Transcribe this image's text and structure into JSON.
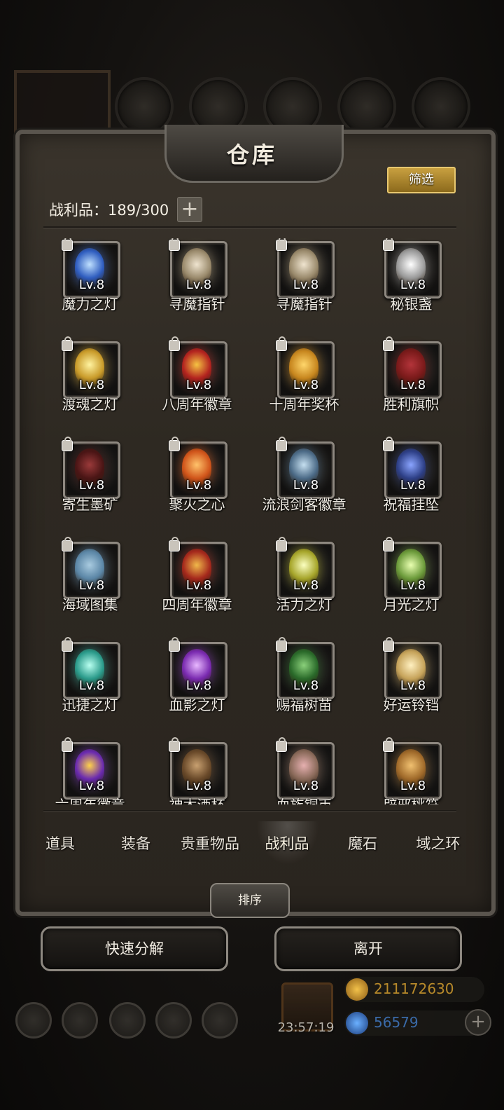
{
  "window": {
    "title": "仓库"
  },
  "toolbar": {
    "filter_label": "筛选",
    "capacity_text": "战利品：189/300",
    "capacity_add": "+"
  },
  "items": [
    {
      "name": "魔力之灯",
      "level": "Lv.8",
      "icon": "blue-lantern-icon",
      "color": "#2f5dbf",
      "core": "#bfe0ff"
    },
    {
      "name": "寻魔指针",
      "level": "Lv.8",
      "icon": "compass-icon",
      "color": "#9a8a6c",
      "core": "#efe4cf"
    },
    {
      "name": "寻魔指针",
      "level": "Lv.8",
      "icon": "compass-icon",
      "color": "#9a8a6c",
      "core": "#efe4cf"
    },
    {
      "name": "秘银盏",
      "level": "Lv.8",
      "icon": "silver-chalice-icon",
      "color": "#9a9a9a",
      "core": "#ffffff"
    },
    {
      "name": "渡魂之灯",
      "level": "Lv.8",
      "icon": "yellow-lantern-icon",
      "color": "#c99b2a",
      "core": "#fff3a0"
    },
    {
      "name": "八周年徽章",
      "level": "Lv.8",
      "icon": "eighth-anniversary-badge-icon",
      "color": "#b3231f",
      "core": "#f5c342"
    },
    {
      "name": "十周年奖杯",
      "level": "Lv.8",
      "icon": "tenth-anniversary-trophy-icon",
      "color": "#c7861e",
      "core": "#ffd66b"
    },
    {
      "name": "胜利旗帜",
      "level": "Lv.8",
      "icon": "victory-banner-icon",
      "color": "#7a1a1a",
      "core": "#b3343a"
    },
    {
      "name": "寄生墨矿",
      "level": "Lv.8",
      "icon": "parasite-ore-icon",
      "color": "#4a1515",
      "core": "#9a3a3a"
    },
    {
      "name": "聚火之心",
      "level": "Lv.8",
      "icon": "fire-heart-icon",
      "color": "#d0541a",
      "core": "#ffc36b"
    },
    {
      "name": "流浪剑客徽章",
      "level": "Lv.8",
      "icon": "swordsman-badge-icon",
      "color": "#4b6a86",
      "core": "#c5dff0"
    },
    {
      "name": "祝福挂坠",
      "level": "Lv.8",
      "icon": "blessing-pendant-icon",
      "color": "#2d3f86",
      "core": "#8aa4ff"
    },
    {
      "name": "海域图集",
      "level": "Lv.8",
      "icon": "sea-atlas-icon",
      "color": "#5b86a6",
      "core": "#a9cbe0"
    },
    {
      "name": "四周年徽章",
      "level": "Lv.8",
      "icon": "fourth-anniversary-badge-icon",
      "color": "#a5281c",
      "core": "#f0b84a"
    },
    {
      "name": "活力之灯",
      "level": "Lv.8",
      "icon": "green-yellow-lantern-icon",
      "color": "#a6a52a",
      "core": "#fbffc0"
    },
    {
      "name": "月光之灯",
      "level": "Lv.8",
      "icon": "moonlight-lantern-icon",
      "color": "#6b9a3a",
      "core": "#e9ffb0"
    },
    {
      "name": "迅捷之灯",
      "level": "Lv.8",
      "icon": "swift-lantern-icon",
      "color": "#2a9a8a",
      "core": "#b8fff0"
    },
    {
      "name": "血影之灯",
      "level": "Lv.8",
      "icon": "purple-lantern-icon",
      "color": "#7a2ab0",
      "core": "#e8b8ff"
    },
    {
      "name": "赐福树苗",
      "level": "Lv.8",
      "icon": "sapling-tree-icon",
      "color": "#2a6a2a",
      "core": "#8ad07a"
    },
    {
      "name": "好运铃铛",
      "level": "Lv.8",
      "icon": "lucky-bell-icon",
      "color": "#c6a35a",
      "core": "#fff0c0"
    },
    {
      "name": "六周年徽章",
      "level": "Lv.8",
      "icon": "sixth-anniversary-badge-icon",
      "color": "#6a2ab0",
      "core": "#ffd24a"
    },
    {
      "name": "神木酒杯",
      "level": "Lv.8",
      "icon": "wooden-mug-icon",
      "color": "#6a4a2a",
      "core": "#c8a070"
    },
    {
      "name": "血族铜币",
      "level": "Lv.8",
      "icon": "vampire-coin-icon",
      "color": "#8a6a5a",
      "core": "#e6b0b0"
    },
    {
      "name": "辟邪桃符",
      "level": "Lv.8",
      "icon": "peach-charm-icon",
      "color": "#a06a2a",
      "core": "#f0c070"
    }
  ],
  "tabs": [
    "道具",
    "装备",
    "贵重物品",
    "战利品",
    "魔石",
    "域之环"
  ],
  "active_tab": "战利品",
  "actions": {
    "sort_label": "排序",
    "decompose_label": "快速分解",
    "leave_label": "离开"
  },
  "footer": {
    "timer": "23:57:19",
    "gold": "211172630",
    "gems": "56579",
    "add": "+"
  },
  "colors": {
    "accent_gold": "#c8a040",
    "gold_text": "#b88a2a",
    "gem_text": "#3a6aa8"
  }
}
